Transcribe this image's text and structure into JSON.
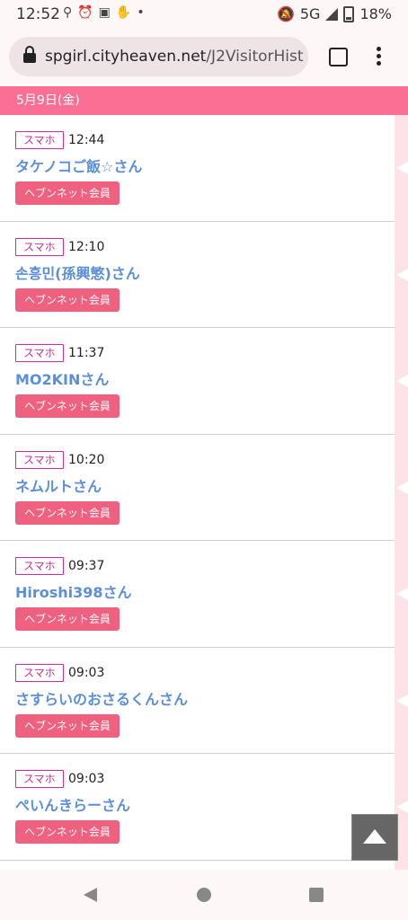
{
  "status_bar": {
    "time": "12:52",
    "network": "5G",
    "battery": "18%"
  },
  "browser": {
    "url_domain": "spgirl.cityheaven.net",
    "url_path": "/J2VisitorHist"
  },
  "date_header": "5月9日(金)",
  "visitors": [
    {
      "device": "スマホ",
      "time": "12:44",
      "name": "タケノコご飯☆さん",
      "member": "ヘブンネット会員"
    },
    {
      "device": "スマホ",
      "time": "12:10",
      "name": "손흥민(孫興慜)さん",
      "member": "ヘブンネット会員"
    },
    {
      "device": "スマホ",
      "time": "11:37",
      "name": "MO2KINさん",
      "member": "ヘブンネット会員"
    },
    {
      "device": "スマホ",
      "time": "10:20",
      "name": "ネムルトさん",
      "member": "ヘブンネット会員"
    },
    {
      "device": "スマホ",
      "time": "09:37",
      "name": "Hiroshi398さん",
      "member": "ヘブンネット会員"
    },
    {
      "device": "スマホ",
      "time": "09:03",
      "name": "さすらいのおさるくんさん",
      "member": "ヘブンネット会員"
    },
    {
      "device": "スマホ",
      "time": "09:03",
      "name": "ぺいんきらーさん",
      "member": "ヘブンネット会員"
    }
  ]
}
